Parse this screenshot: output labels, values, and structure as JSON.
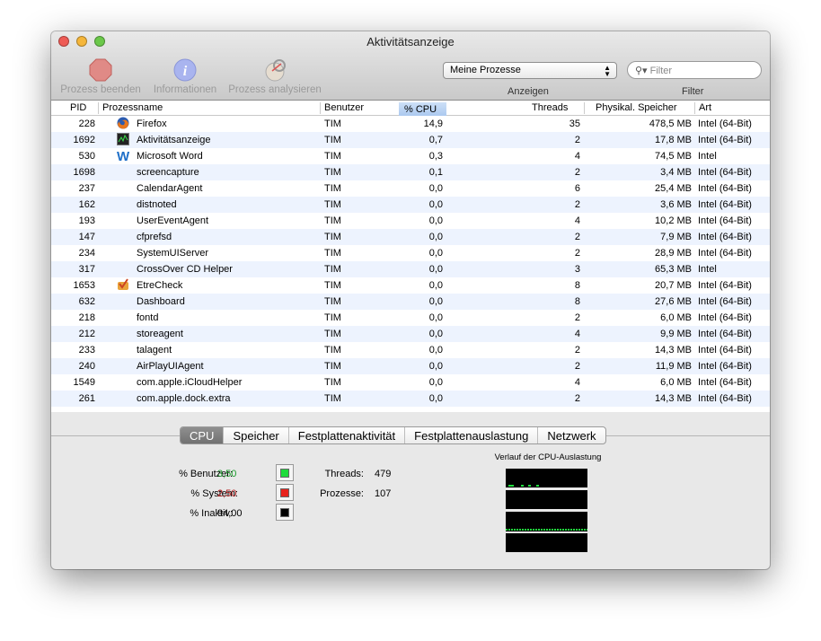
{
  "window": {
    "title": "Aktivitätsanzeige"
  },
  "toolbar": {
    "quit": "Prozess beenden",
    "info": "Informationen",
    "analyze": "Prozess analysieren",
    "show_select": "Meine Prozesse",
    "show_label": "Anzeigen",
    "filter_placeholder": "Filter",
    "filter_label": "Filter"
  },
  "columns": {
    "pid": "PID",
    "name": "Prozessname",
    "user": "Benutzer",
    "cpu": "% CPU",
    "threads": "Threads",
    "mem": "Physikal. Speicher",
    "art": "Art"
  },
  "processes": [
    {
      "pid": "228",
      "name": "Firefox",
      "icon": "firefox",
      "user": "TIM",
      "cpu": "14,9",
      "threads": "35",
      "mem": "478,5 MB",
      "art": "Intel (64-Bit)"
    },
    {
      "pid": "1692",
      "name": "Aktivitätsanzeige",
      "icon": "activity",
      "user": "TIM",
      "cpu": "0,7",
      "threads": "2",
      "mem": "17,8 MB",
      "art": "Intel (64-Bit)"
    },
    {
      "pid": "530",
      "name": "Microsoft Word",
      "icon": "word",
      "user": "TIM",
      "cpu": "0,3",
      "threads": "4",
      "mem": "74,5 MB",
      "art": "Intel"
    },
    {
      "pid": "1698",
      "name": "screencapture",
      "icon": "",
      "user": "TIM",
      "cpu": "0,1",
      "threads": "2",
      "mem": "3,4 MB",
      "art": "Intel (64-Bit)"
    },
    {
      "pid": "237",
      "name": "CalendarAgent",
      "icon": "",
      "user": "TIM",
      "cpu": "0,0",
      "threads": "6",
      "mem": "25,4 MB",
      "art": "Intel (64-Bit)"
    },
    {
      "pid": "162",
      "name": "distnoted",
      "icon": "",
      "user": "TIM",
      "cpu": "0,0",
      "threads": "2",
      "mem": "3,6 MB",
      "art": "Intel (64-Bit)"
    },
    {
      "pid": "193",
      "name": "UserEventAgent",
      "icon": "",
      "user": "TIM",
      "cpu": "0,0",
      "threads": "4",
      "mem": "10,2 MB",
      "art": "Intel (64-Bit)"
    },
    {
      "pid": "147",
      "name": "cfprefsd",
      "icon": "",
      "user": "TIM",
      "cpu": "0,0",
      "threads": "2",
      "mem": "7,9 MB",
      "art": "Intel (64-Bit)"
    },
    {
      "pid": "234",
      "name": "SystemUIServer",
      "icon": "",
      "user": "TIM",
      "cpu": "0,0",
      "threads": "2",
      "mem": "28,9 MB",
      "art": "Intel (64-Bit)"
    },
    {
      "pid": "317",
      "name": "CrossOver CD Helper",
      "icon": "",
      "user": "TIM",
      "cpu": "0,0",
      "threads": "3",
      "mem": "65,3 MB",
      "art": "Intel"
    },
    {
      "pid": "1653",
      "name": "EtreCheck",
      "icon": "etrecheck",
      "user": "TIM",
      "cpu": "0,0",
      "threads": "8",
      "mem": "20,7 MB",
      "art": "Intel (64-Bit)"
    },
    {
      "pid": "632",
      "name": "Dashboard",
      "icon": "",
      "user": "TIM",
      "cpu": "0,0",
      "threads": "8",
      "mem": "27,6 MB",
      "art": "Intel (64-Bit)"
    },
    {
      "pid": "218",
      "name": "fontd",
      "icon": "",
      "user": "TIM",
      "cpu": "0,0",
      "threads": "2",
      "mem": "6,0 MB",
      "art": "Intel (64-Bit)"
    },
    {
      "pid": "212",
      "name": "storeagent",
      "icon": "",
      "user": "TIM",
      "cpu": "0,0",
      "threads": "4",
      "mem": "9,9 MB",
      "art": "Intel (64-Bit)"
    },
    {
      "pid": "233",
      "name": "talagent",
      "icon": "",
      "user": "TIM",
      "cpu": "0,0",
      "threads": "2",
      "mem": "14,3 MB",
      "art": "Intel (64-Bit)"
    },
    {
      "pid": "240",
      "name": "AirPlayUIAgent",
      "icon": "",
      "user": "TIM",
      "cpu": "0,0",
      "threads": "2",
      "mem": "11,9 MB",
      "art": "Intel (64-Bit)"
    },
    {
      "pid": "1549",
      "name": "com.apple.iCloudHelper",
      "icon": "",
      "user": "TIM",
      "cpu": "0,0",
      "threads": "4",
      "mem": "6,0 MB",
      "art": "Intel (64-Bit)"
    },
    {
      "pid": "261",
      "name": "com.apple.dock.extra",
      "icon": "",
      "user": "TIM",
      "cpu": "0,0",
      "threads": "2",
      "mem": "14,3 MB",
      "art": "Intel (64-Bit)"
    }
  ],
  "tabs": [
    "CPU",
    "Speicher",
    "Festplattenaktivität",
    "Festplattenauslastung",
    "Netzwerk"
  ],
  "cpu": {
    "user_label": "% Benutzer:",
    "user": "3,50",
    "system_label": "% System:",
    "system": "2,50",
    "idle_label": "% Inaktiv:",
    "idle": "94,00",
    "threads_label": "Threads:",
    "threads": "479",
    "procs_label": "Prozesse:",
    "procs": "107",
    "history_title": "Verlauf der CPU-Auslastung"
  },
  "colors": {
    "user": "#1fdc3c",
    "system": "#e8231d",
    "idle": "#000000"
  }
}
